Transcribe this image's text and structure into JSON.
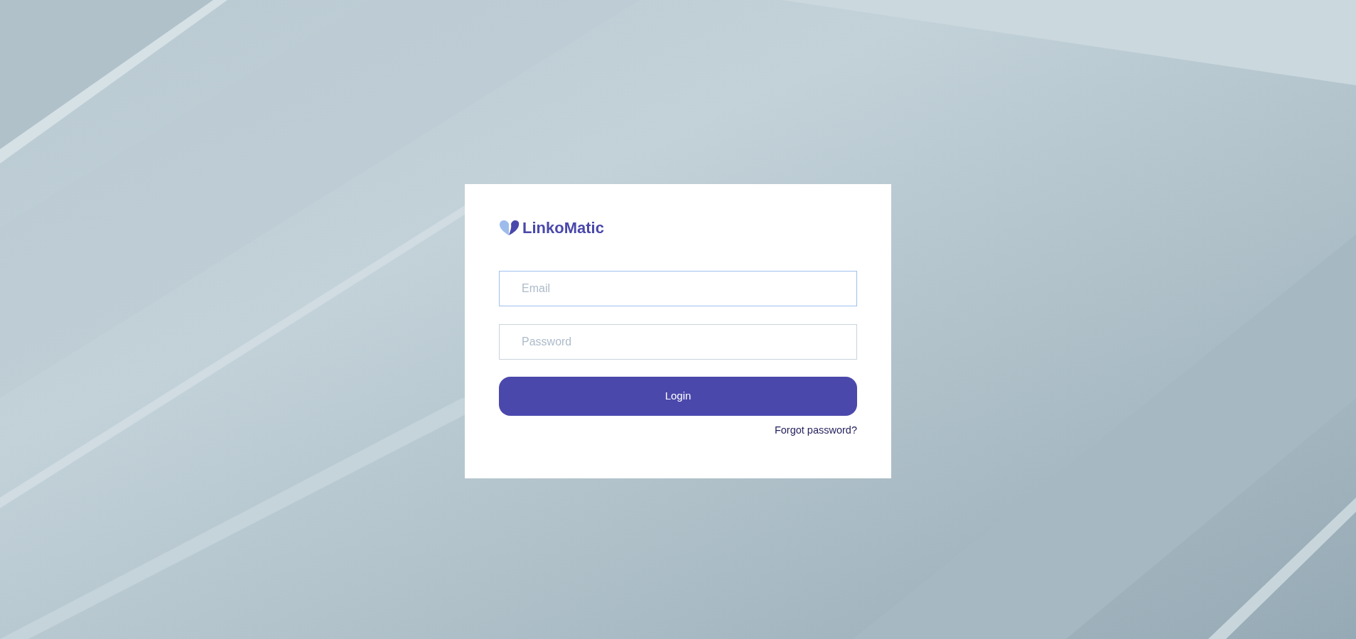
{
  "logo": {
    "text": "LinkoMatic"
  },
  "fields": [
    {
      "placeholder": "Email",
      "focused": true
    },
    {
      "placeholder": "Password",
      "focused": false
    }
  ],
  "login_button": {
    "label": "Login"
  },
  "forgot_link": {
    "label": "Forgot password?"
  }
}
